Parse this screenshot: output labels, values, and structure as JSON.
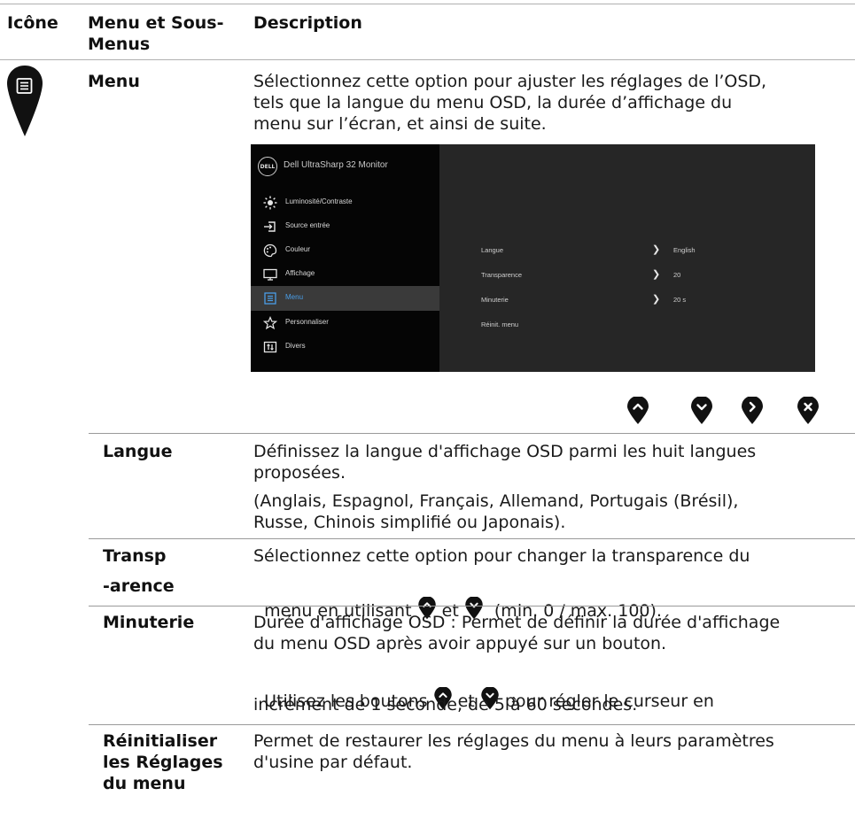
{
  "header": {
    "col_icon": "Icône",
    "col_menu_line1": "Menu et Sous-",
    "col_menu_line2": "Menus",
    "col_desc": "Description"
  },
  "menu": {
    "label": "Menu",
    "desc_lines": [
      "Sélectionnez cette option pour ajuster les réglages de l’OSD,",
      "tels que la langue du menu OSD, la durée d’affichage du",
      "menu sur l’écran, et ainsi de suite."
    ],
    "icon": "menu-pin-icon"
  },
  "osd": {
    "logo": "DELL",
    "title": "Dell UltraSharp 32 Monitor",
    "items": [
      {
        "label": "Luminosité/Contraste",
        "icon": "brightness-icon"
      },
      {
        "label": "Source entrée",
        "icon": "input-source-icon"
      },
      {
        "label": "Couleur",
        "icon": "color-palette-icon"
      },
      {
        "label": "Affichage",
        "icon": "display-icon"
      },
      {
        "label": "Menu",
        "icon": "menu-icon"
      },
      {
        "label": "Personnaliser",
        "icon": "star-icon"
      },
      {
        "label": "Divers",
        "icon": "others-icon"
      }
    ],
    "active_item": "Menu",
    "rows": [
      {
        "name": "Langue",
        "value": "English",
        "arrow": true
      },
      {
        "name": "Transparence",
        "value": "20",
        "arrow": true
      },
      {
        "name": "Minuterie",
        "value": "20 s",
        "arrow": true
      },
      {
        "name": "Réinit. menu",
        "value": "",
        "arrow": false
      }
    ]
  },
  "nav_buttons": [
    "up-button-icon",
    "down-button-icon",
    "right-button-icon",
    "close-button-icon"
  ],
  "langue": {
    "label": "Langue",
    "desc_lines": [
      "Définissez la langue d'affichage OSD parmi les huit langues",
      "proposées."
    ],
    "desc2_lines": [
      "(Anglais, Espagnol, Français, Allemand, Portugais (Brésil),",
      "Russe, Chinois simplifié ou Japonais)."
    ]
  },
  "transparence": {
    "label_line1": "Transp",
    "label_line2": "-arence",
    "desc_line1": "Sélectionnez cette option pour changer la transparence du",
    "desc_line2_a": "menu en utilisant ",
    "desc_line2_b": " et ",
    "desc_line2_c": "  (min. 0 / max. 100)."
  },
  "minuterie": {
    "label": "Minuterie",
    "desc_lines": [
      "Durée d'affichage OSD : Permet de définir la durée d'affichage",
      "du menu OSD après avoir appuyé sur un bouton."
    ],
    "desc2_a": "Utilisez les boutons ",
    "desc2_b": " et ",
    "desc2_c": " pour régler le curseur en",
    "desc2_line2": "incrément de 1 seconde, de 5 à 60 secondes."
  },
  "reinit": {
    "label_lines": [
      "Réinitialiser",
      "les Réglages",
      "du menu"
    ],
    "desc_lines": [
      "Permet de restaurer les réglages du menu à leurs paramètres",
      "d'usine par défaut."
    ]
  }
}
